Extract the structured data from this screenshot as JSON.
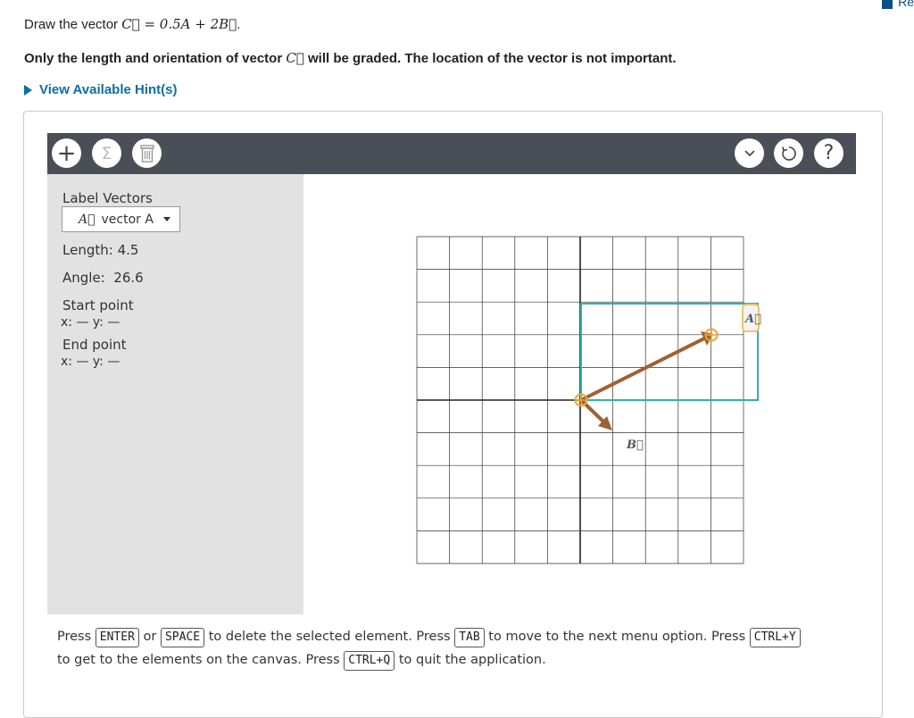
{
  "page": {
    "corner_text": "Re",
    "prompt": {
      "prefix": "Draw the vector ",
      "math": "C⃗ = 0.5A + 2B⃗",
      "suffix": "."
    },
    "instruction": {
      "part1": "Only the length and orientation of vector ",
      "math": "C⃗",
      "part2": " will be graded. The location of the vector is not important."
    },
    "hint_link": "View Available Hint(s)"
  },
  "toolbar": {
    "add_label": "+",
    "sum_label": "Σ",
    "delete_icon": "trash-icon",
    "chevron_label": "⌄",
    "reset_icon": "reset-icon",
    "help_label": "?"
  },
  "sidebar": {
    "heading": "Label Vectors",
    "dropdown_symbol": "A⃗",
    "dropdown_value": "vector A",
    "length_label": "Length:",
    "length_value": "4.5",
    "angle_label": "Angle:",
    "angle_value": "26.6",
    "start_label": "Start point",
    "start_coords": "x: — y: —",
    "end_label": "End point",
    "end_coords": "x: — y: —"
  },
  "canvas": {
    "vector_a_label": "A⃗",
    "vector_b_label": "B⃗",
    "vector_color": "#9e6132",
    "selection_color": "#2bb3b0",
    "handle_color": "#f0a13a"
  },
  "keyboard_help": {
    "press1": "Press ",
    "enter": "ENTER",
    "or": " or ",
    "space": "SPACE",
    "t1": " to delete the selected element. Press ",
    "tab": "TAB",
    "t2": " to move to the next menu option. Press ",
    "ctrly": "CTRL+Y",
    "t3": " to get to the elements on the canvas. Press ",
    "ctrlq": "CTRL+Q",
    "t4": " to quit the application."
  }
}
